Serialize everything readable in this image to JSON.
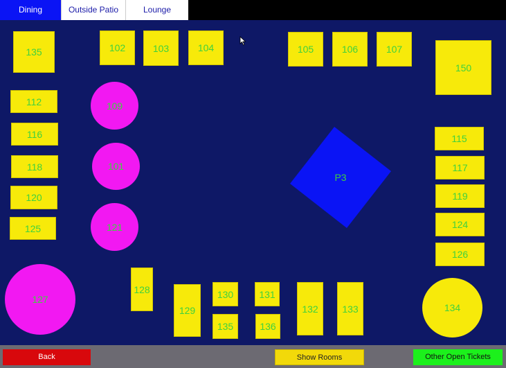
{
  "tabs": [
    {
      "label": "Dining",
      "active": true
    },
    {
      "label": "Outside Patio",
      "active": false
    },
    {
      "label": "Lounge",
      "active": false
    }
  ],
  "tables": {
    "t135a": "135",
    "t102": "102",
    "t103": "103",
    "t104": "104",
    "t105": "105",
    "t106": "106",
    "t107": "107",
    "t150": "150",
    "t112": "112",
    "t109": "109",
    "t116": "116",
    "t118": "118",
    "t101": "101",
    "t120": "120",
    "t125": "125",
    "t121": "121",
    "tP3": "P3",
    "t115": "115",
    "t117": "117",
    "t119": "119",
    "t124": "124",
    "t126": "126",
    "t127": "127",
    "t128": "128",
    "t129": "129",
    "t130": "130",
    "t131": "131",
    "t135b": "135",
    "t136": "136",
    "t132": "132",
    "t133": "133",
    "t134": "134"
  },
  "buttons": {
    "back": "Back",
    "show_rooms": "Show Rooms",
    "other_open_tickets": "Other Open Tickets"
  },
  "colors": {
    "floor": "#0e1866",
    "square_table": "#f7ea0a",
    "round_table_magenta": "#f218f2",
    "table_label": "#3fd13f",
    "p3_table": "#0a14f5",
    "active_tab": "#0a14f5",
    "back_button": "#d8080c",
    "show_rooms_button": "#f2d90a",
    "other_tickets_button": "#1cf01c"
  }
}
